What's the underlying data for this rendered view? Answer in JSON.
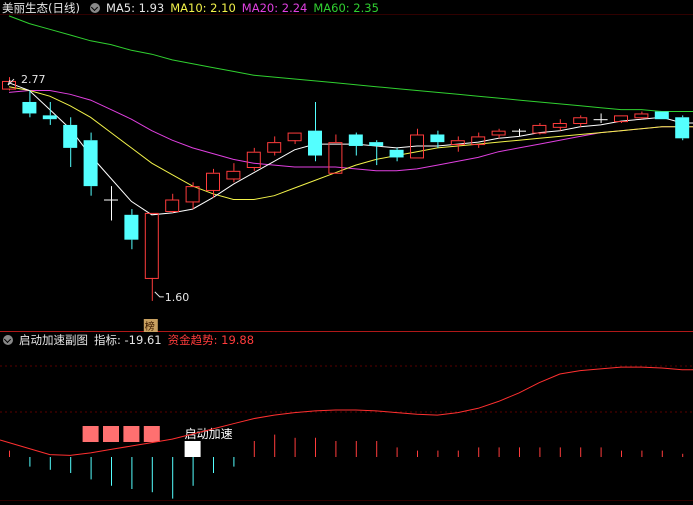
{
  "price_panel": {
    "title": "美丽生态(日线)",
    "ma5_label": "MA5: 1.93",
    "ma10_label": "MA10: 2.10",
    "ma20_label": "MA20: 2.24",
    "ma60_label": "MA60: 2.35",
    "high_label": "2.77",
    "low_label": "1.60",
    "badge": "榜",
    "colors": {
      "ma5": "#ffffff",
      "ma10": "#f2f24a",
      "ma20": "#e040e0",
      "ma60": "#30d030",
      "up": "#ff3c3c",
      "down": "#54ffff"
    }
  },
  "indicator_panel": {
    "title": "启动加速副图",
    "index_label": "指标: -19.61",
    "fund_label": "资金趋势: 19.88",
    "signal_label": "启动加速"
  },
  "chart_data": {
    "type": "candlestick",
    "ylim": [
      1.5,
      3.1
    ],
    "candles": [
      {
        "o": 2.71,
        "c": 2.75,
        "h": 2.77,
        "l": 2.7
      },
      {
        "o": 2.64,
        "c": 2.58,
        "h": 2.7,
        "l": 2.56
      },
      {
        "o": 2.57,
        "c": 2.55,
        "h": 2.64,
        "l": 2.52
      },
      {
        "o": 2.52,
        "c": 2.4,
        "h": 2.56,
        "l": 2.3
      },
      {
        "o": 2.44,
        "c": 2.2,
        "h": 2.48,
        "l": 2.15
      },
      {
        "o": 2.13,
        "c": 2.13,
        "h": 2.2,
        "l": 2.02
      },
      {
        "o": 2.05,
        "c": 1.92,
        "h": 2.08,
        "l": 1.87
      },
      {
        "o": 1.72,
        "c": 2.06,
        "h": 2.06,
        "l": 1.6
      },
      {
        "o": 2.07,
        "c": 2.13,
        "h": 2.16,
        "l": 2.06
      },
      {
        "o": 2.12,
        "c": 2.2,
        "h": 2.22,
        "l": 2.08
      },
      {
        "o": 2.18,
        "c": 2.27,
        "h": 2.29,
        "l": 2.14
      },
      {
        "o": 2.24,
        "c": 2.28,
        "h": 2.32,
        "l": 2.22
      },
      {
        "o": 2.3,
        "c": 2.38,
        "h": 2.4,
        "l": 2.28
      },
      {
        "o": 2.38,
        "c": 2.43,
        "h": 2.46,
        "l": 2.36
      },
      {
        "o": 2.44,
        "c": 2.48,
        "h": 2.48,
        "l": 2.42
      },
      {
        "o": 2.49,
        "c": 2.36,
        "h": 2.64,
        "l": 2.33
      },
      {
        "o": 2.27,
        "c": 2.43,
        "h": 2.47,
        "l": 2.27
      },
      {
        "o": 2.47,
        "c": 2.41,
        "h": 2.48,
        "l": 2.36
      },
      {
        "o": 2.43,
        "c": 2.41,
        "h": 2.44,
        "l": 2.31
      },
      {
        "o": 2.39,
        "c": 2.35,
        "h": 2.4,
        "l": 2.33
      },
      {
        "o": 2.35,
        "c": 2.47,
        "h": 2.5,
        "l": 2.35
      },
      {
        "o": 2.47,
        "c": 2.43,
        "h": 2.49,
        "l": 2.4
      },
      {
        "o": 2.42,
        "c": 2.44,
        "h": 2.46,
        "l": 2.38
      },
      {
        "o": 2.42,
        "c": 2.46,
        "h": 2.48,
        "l": 2.4
      },
      {
        "o": 2.47,
        "c": 2.49,
        "h": 2.5,
        "l": 2.45
      },
      {
        "o": 2.49,
        "c": 2.49,
        "h": 2.5,
        "l": 2.46
      },
      {
        "o": 2.48,
        "c": 2.52,
        "h": 2.53,
        "l": 2.47
      },
      {
        "o": 2.51,
        "c": 2.53,
        "h": 2.55,
        "l": 2.49
      },
      {
        "o": 2.53,
        "c": 2.56,
        "h": 2.57,
        "l": 2.51
      },
      {
        "o": 2.55,
        "c": 2.55,
        "h": 2.58,
        "l": 2.53
      },
      {
        "o": 2.54,
        "c": 2.57,
        "h": 2.57,
        "l": 2.53
      },
      {
        "o": 2.56,
        "c": 2.58,
        "h": 2.59,
        "l": 2.55
      },
      {
        "o": 2.59,
        "c": 2.55,
        "h": 2.59,
        "l": 2.55
      },
      {
        "o": 2.56,
        "c": 2.45,
        "h": 2.57,
        "l": 2.44
      }
    ],
    "ma": {
      "ma5": [
        2.74,
        2.7,
        2.6,
        2.5,
        2.36,
        2.24,
        2.12,
        2.05,
        2.06,
        2.08,
        2.14,
        2.21,
        2.27,
        2.33,
        2.39,
        2.42,
        2.42,
        2.42,
        2.41,
        2.4,
        2.41,
        2.41,
        2.42,
        2.43,
        2.45,
        2.46,
        2.48,
        2.49,
        2.51,
        2.52,
        2.54,
        2.55,
        2.56,
        2.53
      ],
      "ma10": [
        2.72,
        2.7,
        2.67,
        2.62,
        2.56,
        2.48,
        2.4,
        2.32,
        2.26,
        2.2,
        2.16,
        2.13,
        2.13,
        2.15,
        2.19,
        2.23,
        2.27,
        2.31,
        2.34,
        2.36,
        2.38,
        2.4,
        2.41,
        2.42,
        2.43,
        2.44,
        2.45,
        2.46,
        2.47,
        2.48,
        2.49,
        2.5,
        2.51,
        2.51
      ],
      "ma20": [
        2.69,
        2.7,
        2.7,
        2.68,
        2.65,
        2.6,
        2.55,
        2.49,
        2.44,
        2.4,
        2.37,
        2.34,
        2.32,
        2.31,
        2.3,
        2.3,
        2.3,
        2.29,
        2.28,
        2.28,
        2.29,
        2.31,
        2.33,
        2.35,
        2.38,
        2.4,
        2.42,
        2.44,
        2.46,
        2.48,
        2.49,
        2.5,
        2.51,
        2.51
      ],
      "ma60": [
        3.09,
        3.05,
        3.02,
        2.99,
        2.96,
        2.94,
        2.91,
        2.89,
        2.86,
        2.84,
        2.82,
        2.8,
        2.78,
        2.77,
        2.76,
        2.75,
        2.74,
        2.73,
        2.72,
        2.71,
        2.7,
        2.69,
        2.68,
        2.67,
        2.66,
        2.65,
        2.64,
        2.63,
        2.62,
        2.61,
        2.6,
        2.6,
        2.59,
        2.59
      ]
    },
    "fund_trend": [
      -8,
      -15,
      -22,
      -23,
      -20,
      -16,
      -12,
      -8,
      -4,
      2,
      8,
      14,
      20,
      24,
      27,
      29,
      30,
      30,
      29,
      27,
      25,
      24,
      27,
      32,
      40,
      50,
      62,
      72,
      76,
      78,
      80,
      80,
      79,
      77
    ],
    "fund_ylim": [
      -40,
      100
    ],
    "signal_blocks": [
      4,
      5,
      6,
      7
    ],
    "signal_white_index": 9,
    "bars": [
      2,
      -3,
      -4,
      -5,
      -7,
      -9,
      -10,
      -11,
      -13,
      -9,
      -5,
      -3,
      5,
      7,
      6,
      6,
      5,
      5,
      5,
      3,
      2,
      2,
      2,
      3,
      3,
      3,
      3,
      3,
      3,
      3,
      2,
      2,
      2,
      1
    ]
  }
}
